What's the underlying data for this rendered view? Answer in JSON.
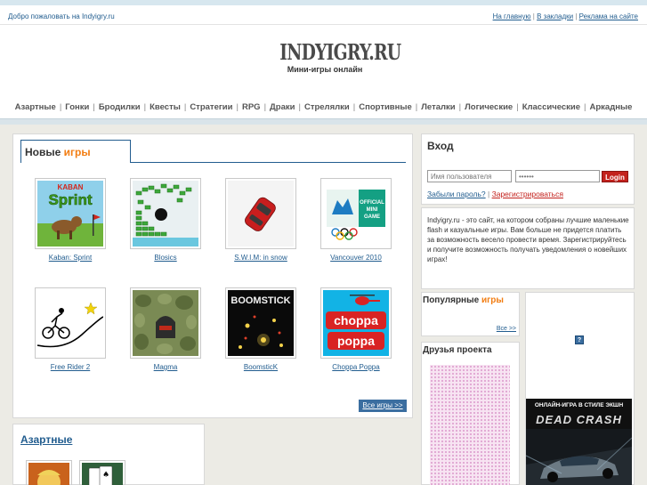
{
  "topbar": {
    "welcome": "Добро пожаловать на Indyigry.ru",
    "links": [
      "На главную",
      "В закладки",
      "Реклама на сайте"
    ]
  },
  "logo": {
    "main": "INDYIGRY.RU",
    "sub": "Мини-игры онлайн"
  },
  "categories": [
    "Азартные",
    "Гонки",
    "Бродилки",
    "Квесты",
    "Стратегии",
    "RPG",
    "Драки",
    "Стрелялки",
    "Спортивные",
    "Леталки",
    "Логические",
    "Классические",
    "Аркадные"
  ],
  "new_games": {
    "title_a": "Новые",
    "title_b": "игры",
    "games": [
      {
        "name": "Kaban: Sprint",
        "icon": "kaban-sprint-thumb"
      },
      {
        "name": "Blosics",
        "icon": "blosics-thumb"
      },
      {
        "name": "S.W.I.M: in snow",
        "icon": "swim-in-snow-thumb"
      },
      {
        "name": "Vancouver 2010",
        "icon": "vancouver-2010-thumb"
      },
      {
        "name": "Free Rider 2",
        "icon": "free-rider-2-thumb"
      },
      {
        "name": "Magma",
        "icon": "magma-thumb"
      },
      {
        "name": "BoomsticK",
        "icon": "boomstick-thumb"
      },
      {
        "name": "Choppa Poppa",
        "icon": "choppa-poppa-thumb"
      }
    ],
    "thumb_texts": {
      "kaban_top": "KABAN",
      "kaban_bottom": "Sprint",
      "vancouver_badge": "OFFICIAL MINI GAME",
      "boomstick": "BOOMSTICK",
      "choppa": "choppa",
      "poppa": "poppa"
    },
    "all_label": "Все игры >>"
  },
  "login": {
    "title": "Вход",
    "username_placeholder": "Имя пользователя",
    "password_value": "••••••",
    "button": "Login",
    "forgot": "Забыли пароль?",
    "register": "Зарегистрироваться"
  },
  "about": "Indyigry.ru - это сайт, на котором собраны лучшие маленькие flash и казуальные игры. Вам больше не придется платить за возможность весело провести время. Зарегистрируйтесь и получите возможность получать уведомления о новейших играх!",
  "popular": {
    "title_a": "Популярные",
    "title_b": "игры",
    "all_label": "Все >>"
  },
  "friends": {
    "title": "Друзья проекта"
  },
  "ad": {
    "placeholder_icon": "?",
    "banner_text": "ОНЛАЙН-ИГРА В СТИЛЕ ЭКШН",
    "banner_logo": "DEAD CRASH"
  },
  "azart": {
    "title": "Азартные"
  },
  "colors": {
    "accent": "#f27d12",
    "link": "#225d8f",
    "button": "#c3221d",
    "background": "#ecebe5"
  }
}
